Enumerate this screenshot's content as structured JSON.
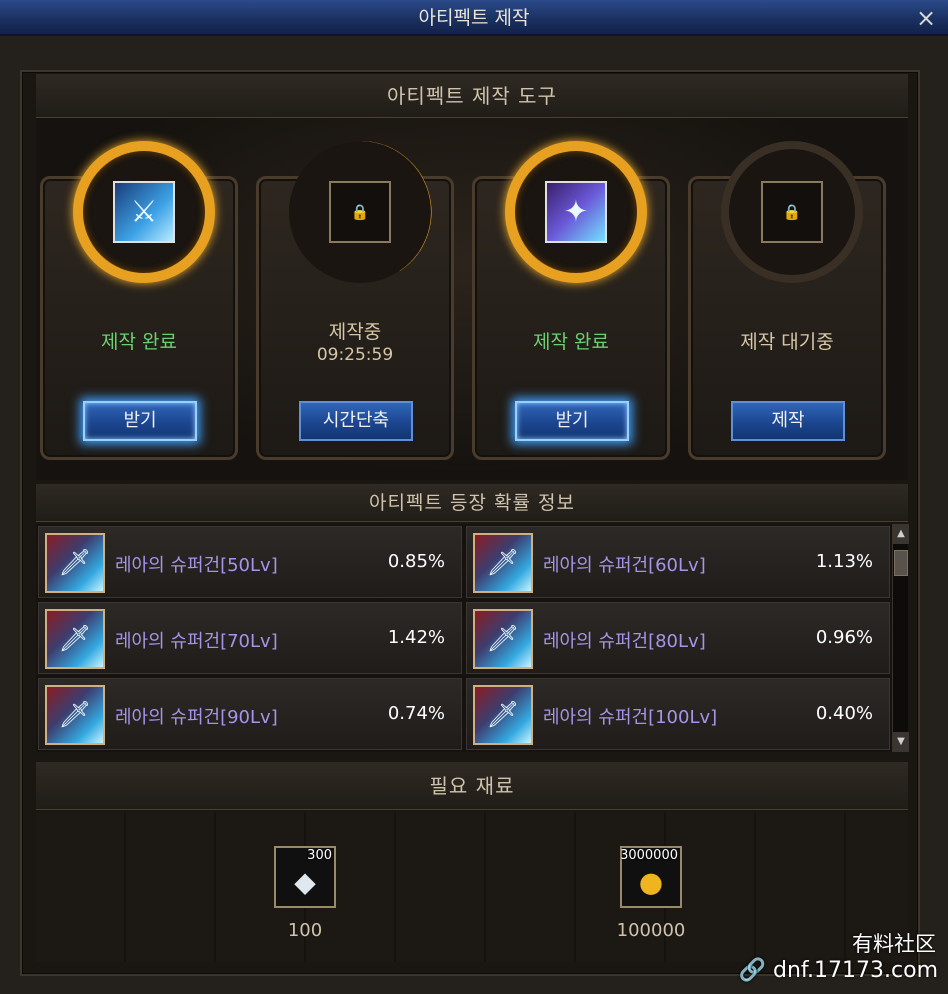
{
  "window": {
    "title": "아티펙트 제작",
    "close_icon": "×"
  },
  "craft": {
    "header": "아티펙트 제작 도구",
    "slots": [
      {
        "status": "제작 완료",
        "timer": "",
        "button": "받기",
        "state": "done",
        "item_icon": "sword-icon"
      },
      {
        "status": "제작중",
        "timer": "09:25:59",
        "button": "시간단축",
        "state": "progress",
        "item_icon": "lock-icon"
      },
      {
        "status": "제작 완료",
        "timer": "",
        "button": "받기",
        "state": "done",
        "item_icon": "staff-icon"
      },
      {
        "status": "제작 대기중",
        "timer": "",
        "button": "제작",
        "state": "idle",
        "item_icon": "lock-icon"
      }
    ]
  },
  "probability": {
    "header": "아티펙트 등장 확률 정보",
    "items": [
      {
        "name": "레아의 슈퍼건[50Lv]",
        "pct": "0.85%"
      },
      {
        "name": "레아의 슈퍼건[60Lv]",
        "pct": "1.13%"
      },
      {
        "name": "레아의 슈퍼건[70Lv]",
        "pct": "1.42%"
      },
      {
        "name": "레아의 슈퍼건[80Lv]",
        "pct": "0.96%"
      },
      {
        "name": "레아의 슈퍼건[90Lv]",
        "pct": "0.74%"
      },
      {
        "name": "레아의 슈퍼건[100Lv]",
        "pct": "0.40%"
      }
    ]
  },
  "materials": {
    "header": "필요 재료",
    "items": [
      {
        "stack": "300",
        "amount": "100",
        "icon": "crystal-icon"
      },
      {
        "stack": "3000000",
        "amount": "100000",
        "icon": "gold-coins-icon"
      }
    ]
  },
  "watermark": {
    "line1": "有料社区",
    "line2": "dnf.17173.com"
  }
}
